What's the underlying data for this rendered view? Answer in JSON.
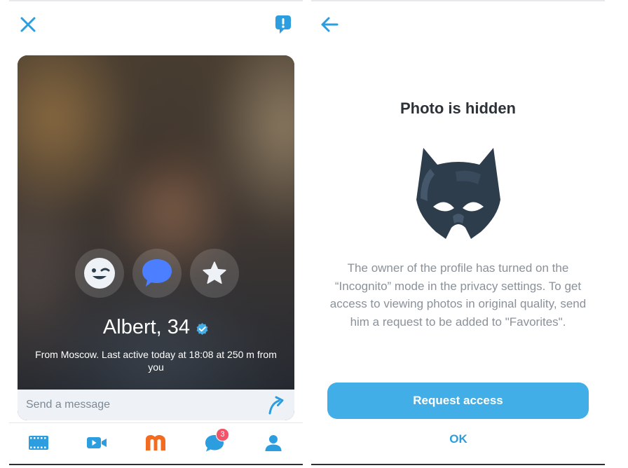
{
  "left": {
    "profile": {
      "name": "Albert, 34",
      "location": "From Moscow. Last active today at 18:08 at 250 m from you"
    },
    "message": {
      "placeholder": "Send a message"
    },
    "tabbar": {
      "messages_badge": "3"
    }
  },
  "right": {
    "title": "Photo is hidden",
    "description": "The owner of the profile has turned on the “Incognito” mode in the privacy settings. To get access to viewing photos in original quality, send him a request to be added to \"Favorites\".",
    "request_button": "Request access",
    "ok_button": "OK"
  },
  "colors": {
    "accent": "#41aee8",
    "icon_blue": "#2c9ee0",
    "brand_orange": "#f26b21",
    "badge_red": "#f2556a",
    "mask_dark": "#2e3d4c"
  },
  "icons": [
    "close-icon",
    "report-icon",
    "back-icon",
    "wink-icon",
    "chat-bubble-icon",
    "star-icon",
    "verified-icon",
    "send-icon",
    "film-icon",
    "video-icon",
    "mamba-logo-icon",
    "messages-icon",
    "profile-icon",
    "incognito-mask-icon"
  ]
}
